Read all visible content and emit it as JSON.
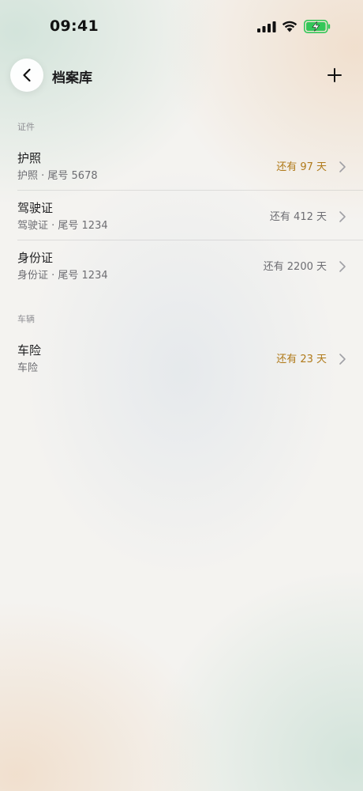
{
  "status_bar": {
    "time": "09:41",
    "icons": [
      "signal-icon",
      "wifi-icon",
      "battery-charging-icon"
    ],
    "battery_color": "#34c759"
  },
  "nav": {
    "title": "档案库",
    "back_icon": "chevron-left-icon",
    "add_icon": "plus-icon"
  },
  "sections": [
    {
      "label": "证件",
      "items": [
        {
          "title": "护照",
          "subtitle": "护照 · 尾号 5678",
          "days": "还有 97 天",
          "highlight": true
        },
        {
          "title": "驾驶证",
          "subtitle": "驾驶证 · 尾号 1234",
          "days": "还有 412 天",
          "highlight": false
        },
        {
          "title": "身份证",
          "subtitle": "身份证 · 尾号 1234",
          "days": "还有 2200 天",
          "highlight": false
        }
      ]
    },
    {
      "label": "车辆",
      "items": [
        {
          "title": "车险",
          "subtitle": "车险",
          "days": "还有 23 天",
          "highlight": true
        }
      ]
    }
  ],
  "colors": {
    "warning_text": "#b07a1a",
    "secondary_text": "#6d6d72",
    "section_label": "#8e8e93"
  }
}
